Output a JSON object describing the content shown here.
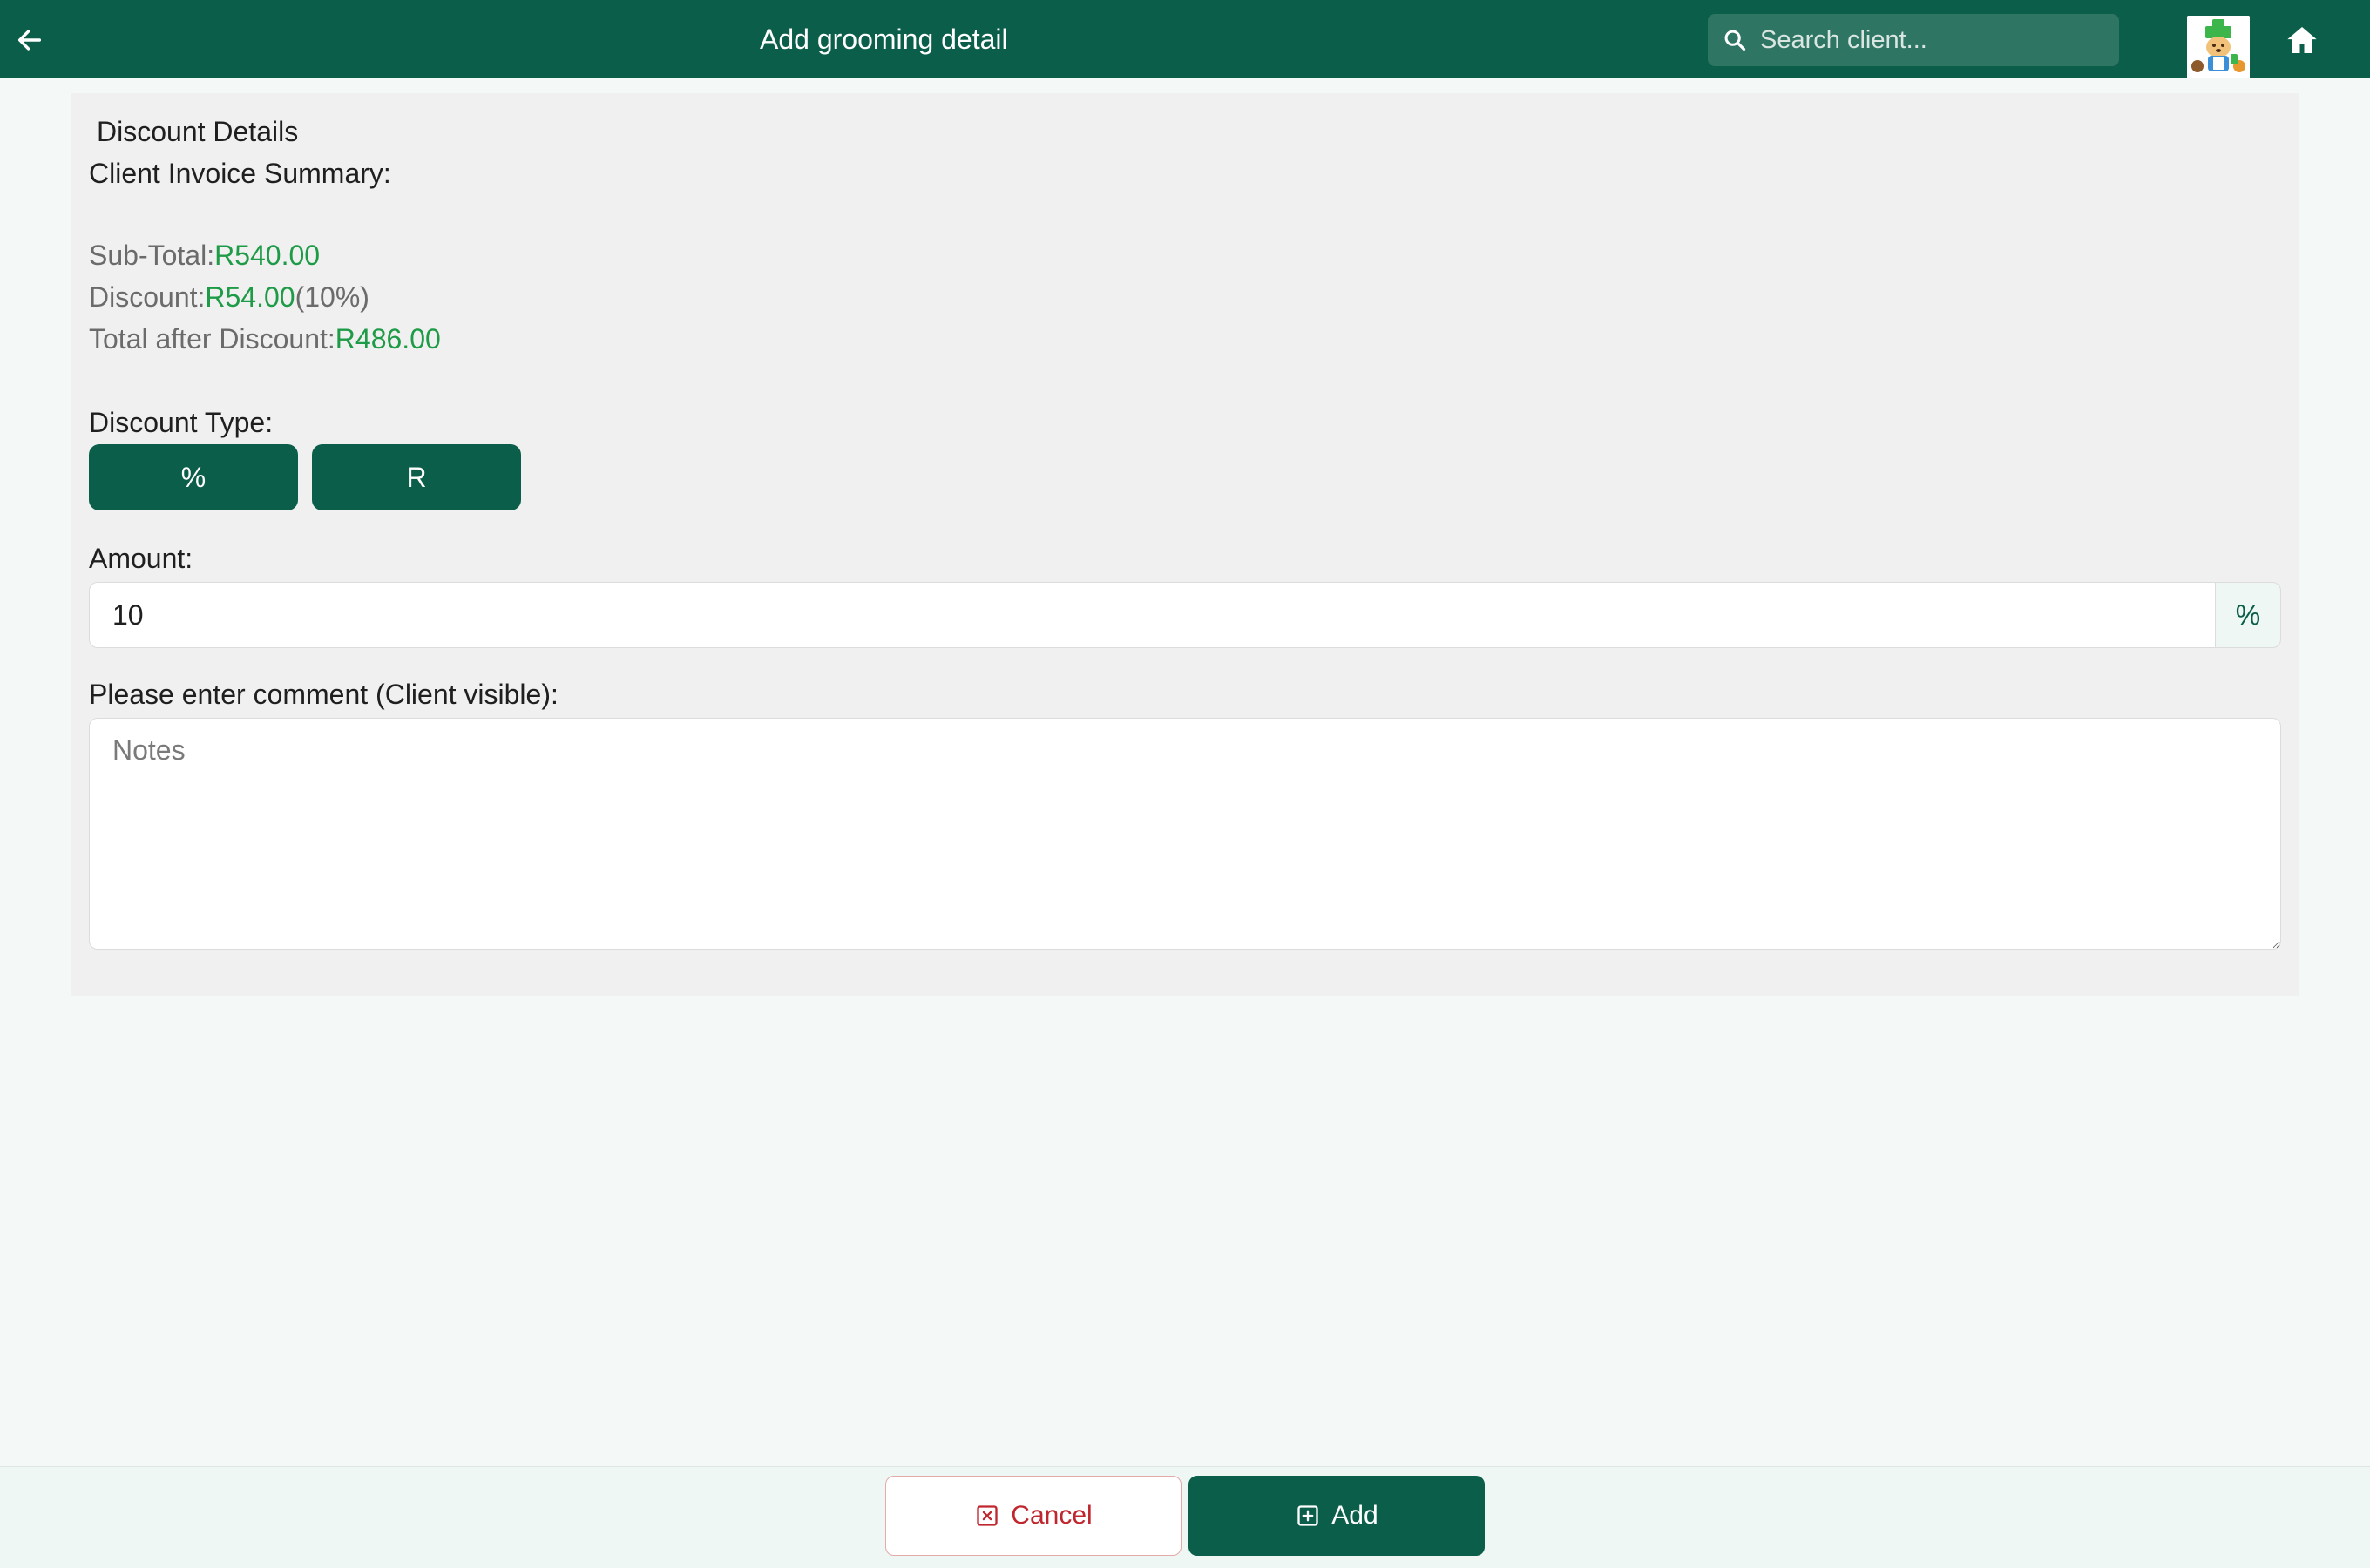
{
  "header": {
    "title": "Add grooming detail",
    "search_placeholder": "Search client..."
  },
  "panel": {
    "title": "Discount Details",
    "summary_title": "Client Invoice Summary:",
    "subtotal_label": "Sub-Total:",
    "subtotal_value": "R540.00",
    "discount_label": "Discount:",
    "discount_value": "R54.00",
    "discount_percent": "(10%)",
    "total_label": "Total after Discount:",
    "total_value": "R486.00",
    "discount_type_label": "Discount Type:",
    "type_percent_label": "%",
    "type_rand_label": "R",
    "amount_label": "Amount:",
    "amount_value": "10",
    "amount_suffix": "%",
    "comment_label": "Please enter comment (Client visible):",
    "comment_placeholder": "Notes"
  },
  "footer": {
    "cancel_label": "Cancel",
    "add_label": "Add"
  },
  "colors": {
    "brand": "#0b5e49",
    "value_green": "#1e9b47",
    "cancel_red": "#c0262d"
  },
  "icons": {
    "back": "arrow-left-icon",
    "search": "search-icon",
    "home": "home-icon",
    "cancel": "close-square-icon",
    "add": "plus-square-icon"
  }
}
